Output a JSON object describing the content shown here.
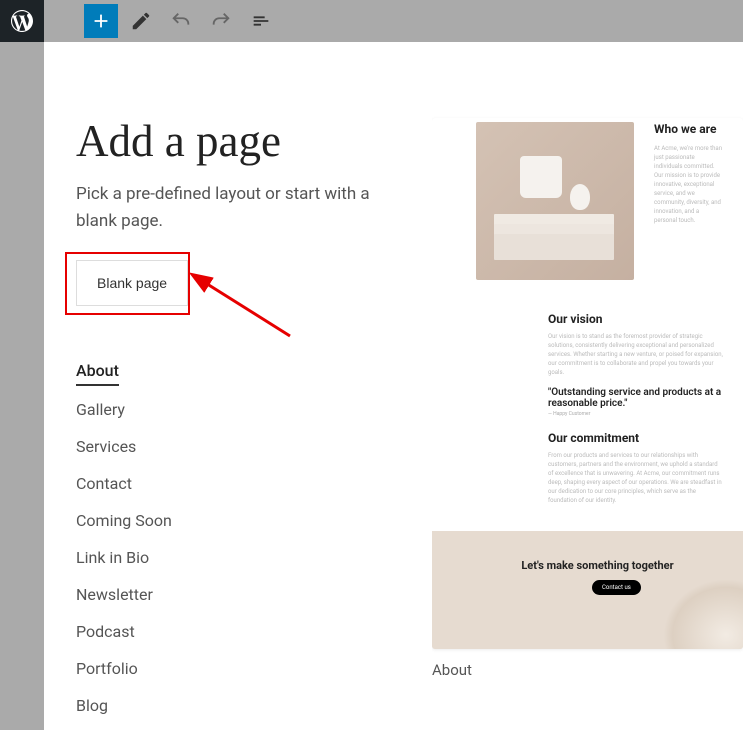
{
  "header": {
    "title": "Add a page",
    "subtitle": "Pick a pre-defined layout or start with a blank page.",
    "blank_button": "Blank page"
  },
  "categories": [
    "About",
    "Gallery",
    "Services",
    "Contact",
    "Coming Soon",
    "Link in Bio",
    "Newsletter",
    "Podcast",
    "Portfolio",
    "Blog"
  ],
  "active_category_index": 0,
  "preview": {
    "label": "About",
    "who_title": "Who we are",
    "who_body": "At Acme, we're more than just passionate individuals committed. Our mission is to provide innovative, exceptional service, and we community, diversity, and innovation, and a personal touch.",
    "vision_title": "Our vision",
    "vision_body": "Our vision is to stand as the foremost provider of strategic solutions, consistently delivering exceptional and personalized services. Whether starting a new venture, or poised for expansion, our commitment is to collaborate and propel you towards your goals.",
    "quote": "\"Outstanding service and products at a reasonable price.\"",
    "quote_cite": "— Happy Customer",
    "commitment_title": "Our commitment",
    "commitment_body": "From our products and services to our relationships with customers, partners and the environment, we uphold a standard of excellence that is unwavering. At Acme, our commitment runs deep, shaping every aspect of our operations. We are steadfast in our dedication to our core principles, which serve as the foundation of our identity.",
    "banner_title": "Let's make something together",
    "banner_cta": "Contact us"
  }
}
